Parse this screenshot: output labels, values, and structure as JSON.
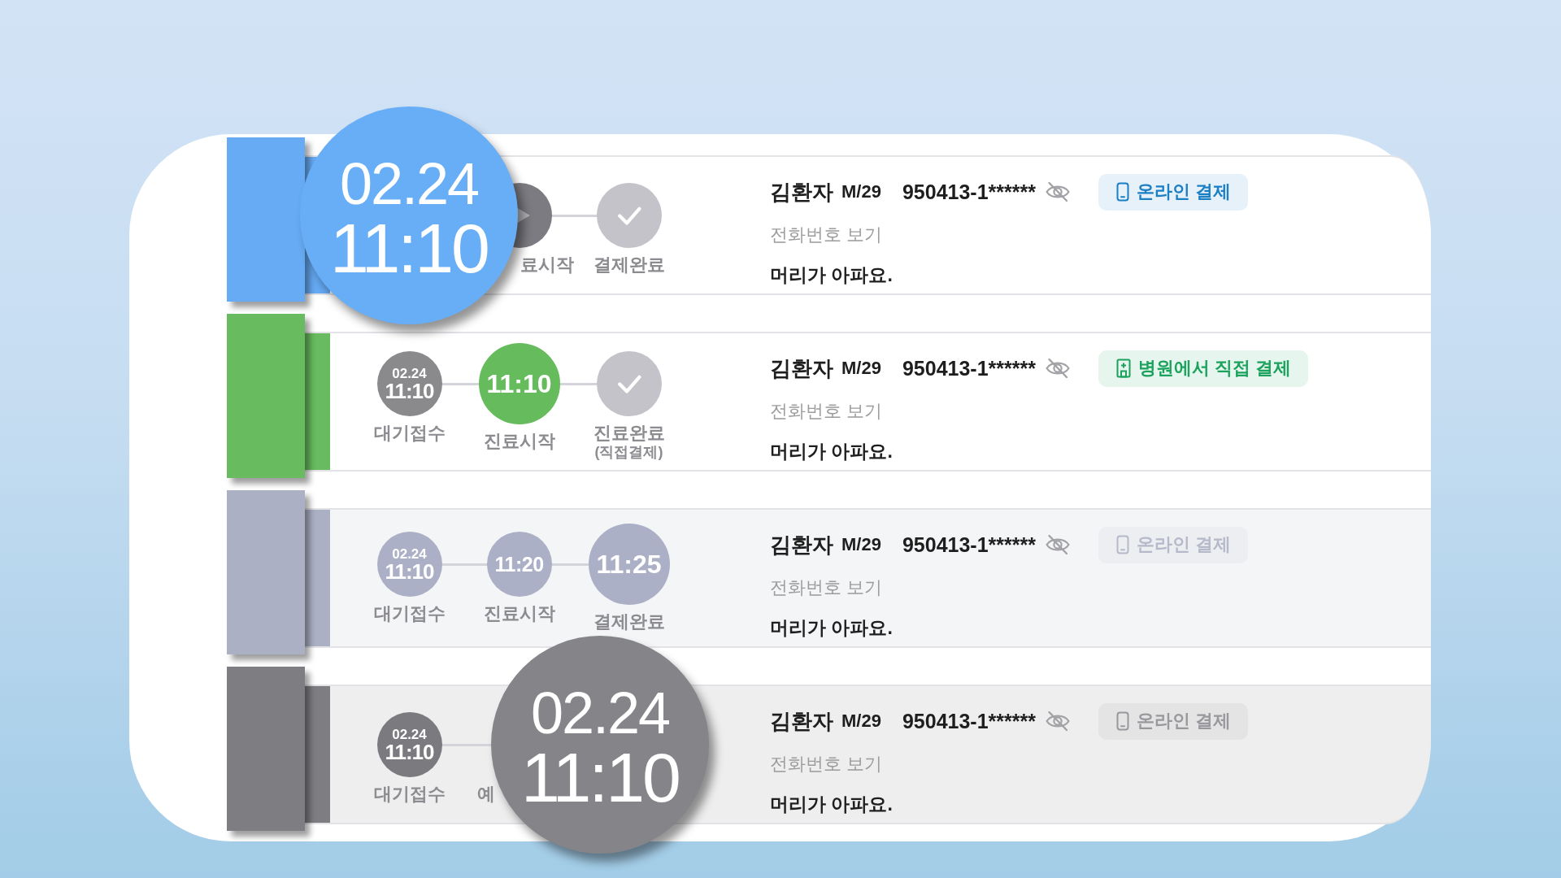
{
  "rows": [
    {
      "color": "#66abf4",
      "dimmed": false,
      "steps": [
        {
          "kind": "magnifier",
          "date": "02.24",
          "time": "11:10",
          "color": "#68aef6"
        },
        {
          "kind": "play",
          "label": "료시작",
          "current": false,
          "color": "#7b7b81"
        },
        {
          "kind": "check",
          "label": "결제완료",
          "current": false,
          "color": "#c3c3c9"
        }
      ],
      "patient": {
        "name": "김환자",
        "sex_age": "M/29",
        "id_number": "950413-1******"
      },
      "phone_link": "전화번호 보기",
      "symptom": "머리가 아파요.",
      "payment": {
        "kind": "online",
        "label": "온라인 결제",
        "color": "#1b7fc4"
      }
    },
    {
      "color": "#68bb5e",
      "dimmed": false,
      "steps": [
        {
          "kind": "time",
          "label": "대기접수",
          "date": "02.24",
          "time": "11:10",
          "current": false,
          "color": "#8a8a8c"
        },
        {
          "kind": "time",
          "label": "진료시작",
          "time": "11:10",
          "current": true,
          "color": "#66bb5c"
        },
        {
          "kind": "check",
          "label": "진료완료",
          "note": "(직접결제)",
          "current": false,
          "color": "#c3c3c9"
        }
      ],
      "patient": {
        "name": "김환자",
        "sex_age": "M/29",
        "id_number": "950413-1******"
      },
      "phone_link": "전화번호 보기",
      "symptom": "머리가 아파요.",
      "payment": {
        "kind": "hospital",
        "label": "병원에서 직접 결제",
        "color": "#1ba25c"
      }
    },
    {
      "color": "#abb0c5",
      "dimmed": true,
      "steps": [
        {
          "kind": "time",
          "label": "대기접수",
          "date": "02.24",
          "time": "11:10",
          "current": false,
          "color": "#acb0c6"
        },
        {
          "kind": "time",
          "label": "진료시작",
          "time": "11:20",
          "current": false,
          "color": "#acb0c6"
        },
        {
          "kind": "time",
          "label": "결제완료",
          "time": "11:25",
          "current": true,
          "color": "#acb0c6"
        }
      ],
      "patient": {
        "name": "김환자",
        "sex_age": "M/29",
        "id_number": "950413-1******"
      },
      "phone_link": "전화번호 보기",
      "symptom": "머리가 아파요.",
      "payment": {
        "kind": "online",
        "label": "온라인 결제",
        "color": "#b6b9ca"
      }
    },
    {
      "color": "#7e7e82",
      "dimmed": true,
      "steps": [
        {
          "kind": "time",
          "label": "대기접수",
          "date": "02.24",
          "time": "11:10",
          "current": false,
          "color": "#7b7b7f"
        },
        {
          "kind": "magnifier",
          "label": "예",
          "date": "02.24",
          "time": "11:10",
          "color": "#858589"
        }
      ],
      "patient": {
        "name": "김환자",
        "sex_age": "M/29",
        "id_number": "950413-1******"
      },
      "phone_link": "전화번호 보기",
      "symptom": "머리가 아파요.",
      "payment": {
        "kind": "online",
        "label": "온라인 결제",
        "color": "#98989d"
      }
    }
  ]
}
